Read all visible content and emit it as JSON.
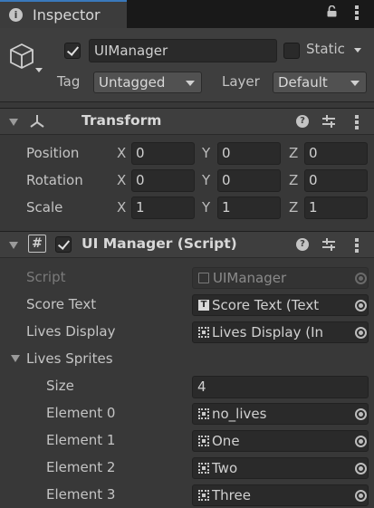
{
  "tab": {
    "icon": "info-icon",
    "title": "Inspector",
    "lock_icon": "lock-icon",
    "menu_icon": "kebab-menu-icon"
  },
  "header": {
    "object_icon": "cube-icon",
    "active": true,
    "name": "UIManager",
    "static_checked": false,
    "static_label": "Static",
    "tag_label": "Tag",
    "tag_value": "Untagged",
    "layer_label": "Layer",
    "layer_value": "Default"
  },
  "transform": {
    "icon": "transform-axes-icon",
    "title": "Transform",
    "rows": [
      {
        "label": "Position",
        "x": "0",
        "y": "0",
        "z": "0"
      },
      {
        "label": "Rotation",
        "x": "0",
        "y": "0",
        "z": "0"
      },
      {
        "label": "Scale",
        "x": "1",
        "y": "1",
        "z": "1"
      }
    ],
    "axis": {
      "x": "X",
      "y": "Y",
      "z": "Z"
    }
  },
  "script_component": {
    "icon": "hash-script-icon",
    "enabled": true,
    "title": "UI Manager (Script)",
    "script_label": "Script",
    "script_value": "UIManager",
    "score_text_label": "Score Text",
    "score_text_value": "Score Text (Text",
    "lives_display_label": "Lives Display",
    "lives_display_value": "Lives Display (In",
    "lives_sprites_label": "Lives Sprites",
    "size_label": "Size",
    "size_value": "4",
    "elements": [
      {
        "label": "Element 0",
        "value": "no_lives"
      },
      {
        "label": "Element 1",
        "value": "One"
      },
      {
        "label": "Element 2",
        "value": "Two"
      },
      {
        "label": "Element 3",
        "value": "Three"
      }
    ]
  },
  "colors": {
    "background": "#383838",
    "field": "#2a2a2a",
    "accent": "#3a79bb",
    "header": "#3e3e3e"
  }
}
